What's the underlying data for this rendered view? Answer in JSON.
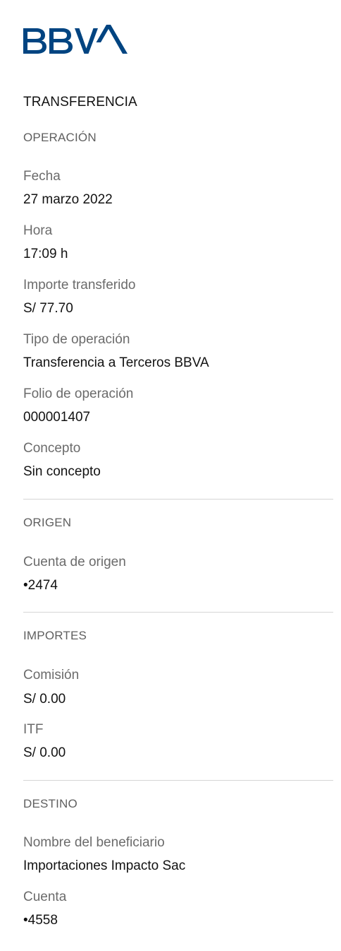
{
  "brand": {
    "logo_text": "BBVA",
    "color": "#004481"
  },
  "title": "TRANSFERENCIA",
  "operacion": {
    "heading": "OPERACIÓN",
    "fecha_label": "Fecha",
    "fecha_value": "27 marzo 2022",
    "hora_label": "Hora",
    "hora_value": "17:09 h",
    "importe_label": "Importe transferido",
    "importe_value": "S/ 77.70",
    "tipo_label": "Tipo de operación",
    "tipo_value": "Transferencia a Terceros BBVA",
    "folio_label": "Folio de operación",
    "folio_value": "000001407",
    "concepto_label": "Concepto",
    "concepto_value": "Sin concepto"
  },
  "origen": {
    "heading": "ORIGEN",
    "cuenta_label": "Cuenta de origen",
    "cuenta_value": "•2474"
  },
  "importes": {
    "heading": "IMPORTES",
    "comision_label": "Comisión",
    "comision_value": "S/ 0.00",
    "itf_label": "ITF",
    "itf_value": "S/ 0.00"
  },
  "destino": {
    "heading": "DESTINO",
    "beneficiario_label": "Nombre del beneficiario",
    "beneficiario_value": "Importaciones Impacto Sac",
    "cuenta_label": "Cuenta",
    "cuenta_value": "•4558"
  }
}
